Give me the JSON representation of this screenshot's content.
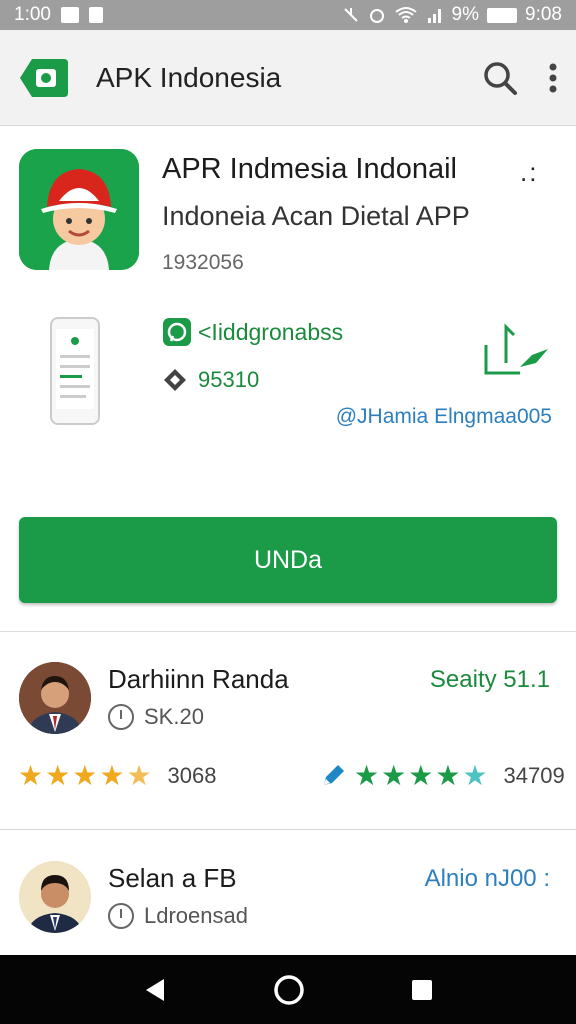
{
  "status_bar": {
    "time_left": "1:00",
    "battery_pct": "9%",
    "time_right": "9:08"
  },
  "app_bar": {
    "title": "APK Indonesia",
    "icons": [
      "play-store-logo-icon",
      "search-icon",
      "more-vert-icon"
    ]
  },
  "app": {
    "name": "APR Indmesia Indonail",
    "more": ":",
    "subtitle": "Indoneia Acan Dietal APP",
    "size": "1932056",
    "developer": "<Iiddgronabss",
    "downloads": "95310",
    "author_link": "@JHamia Elngmaa005",
    "install_label": "UNDa"
  },
  "reviews": [
    {
      "name": "Darhiinn Randa",
      "meta": "SK.20",
      "badge": "Seaity 51.1",
      "stars_left_count": "3068",
      "stars_right_count": "34709",
      "stars_left": 4.5,
      "stars_right": 4.5
    },
    {
      "name": "Selan a FB",
      "meta": "Ldroensad",
      "badge": "Alnio nJ00 :"
    }
  ],
  "colors": {
    "accent_green": "#1b9a48",
    "link_blue": "#2d7fbf",
    "star_orange": "#f0a81e"
  }
}
